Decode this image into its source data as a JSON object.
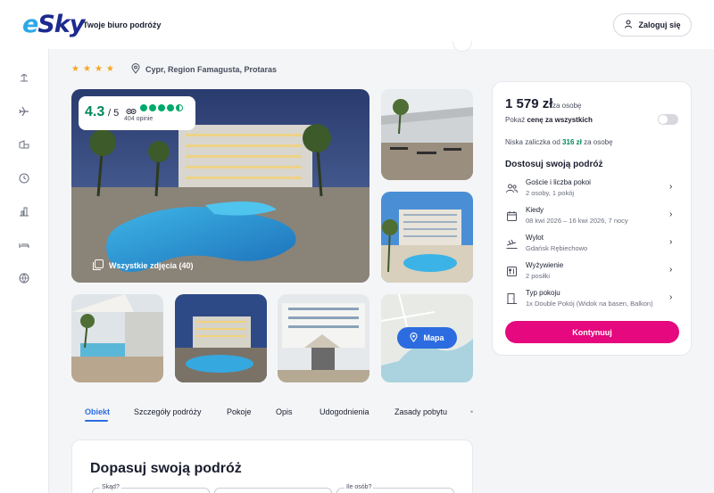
{
  "header": {
    "logo": {
      "e": "e",
      "rest": "Sky"
    },
    "tagline": "Twoje biuro podróży",
    "login_label": "Zaloguj się"
  },
  "sidebar": {
    "icons": [
      "beach-icon",
      "plane-icon",
      "hotel-plane-icon",
      "clock-icon",
      "city-icon",
      "bed-icon",
      "globe-icon"
    ]
  },
  "hotel": {
    "stars": 4,
    "location": "Cypr, Region Famagusta, Protaras"
  },
  "rating": {
    "score": "4.3",
    "max": "/ 5",
    "reviews": "404 opinie",
    "dots_full": 4,
    "dots_total": 5
  },
  "gallery": {
    "all_photos_label": "Wszystkie zdjęcia (40)",
    "map_label": "Mapa"
  },
  "tabs": [
    {
      "label": "Obiekt",
      "active": true
    },
    {
      "label": "Szczegóły podróży",
      "active": false
    },
    {
      "label": "Pokoje",
      "active": false
    },
    {
      "label": "Opis",
      "active": false
    },
    {
      "label": "Udogodnienia",
      "active": false
    },
    {
      "label": "Zasady pobytu",
      "active": false
    }
  ],
  "adjust": {
    "title": "Dopasuj swoją podróż",
    "fields": [
      {
        "label": "Skąd?"
      },
      {
        "label": ""
      },
      {
        "label": "Ile osób?"
      }
    ]
  },
  "panel": {
    "price": "1 579 zł",
    "per_person": "za osobę",
    "show_all_prefix": "Pokaż",
    "show_all_bold": "cenę za wszystkich",
    "deposit_prefix": "Niska zaliczka od",
    "deposit_amount": "316 zł",
    "deposit_suffix": "za osobę",
    "customize_title": "Dostosuj swoją podróż",
    "rows": [
      {
        "title": "Goście i liczba pokoi",
        "sub": "2 osoby, 1 pokój",
        "icon": "guests-icon"
      },
      {
        "title": "Kiedy",
        "sub": "08 kwi 2026 – 16 kwi 2026, 7 nocy",
        "icon": "calendar-icon"
      },
      {
        "title": "Wylot",
        "sub": "Gdańsk Rębiechowo",
        "icon": "departure-icon"
      },
      {
        "title": "Wyżywienie",
        "sub": "2 posiłki",
        "icon": "meals-icon"
      },
      {
        "title": "Typ pokoju",
        "sub": "1x Double Pokój (Widok na basen, Balkon)",
        "icon": "room-icon"
      }
    ],
    "continue_label": "Kontynuuj"
  },
  "colors": {
    "brand_pink": "#e5087e",
    "brand_blue": "#2c6ce0",
    "tripadvisor_green": "#00aa6c",
    "score_green": "#00875a"
  }
}
